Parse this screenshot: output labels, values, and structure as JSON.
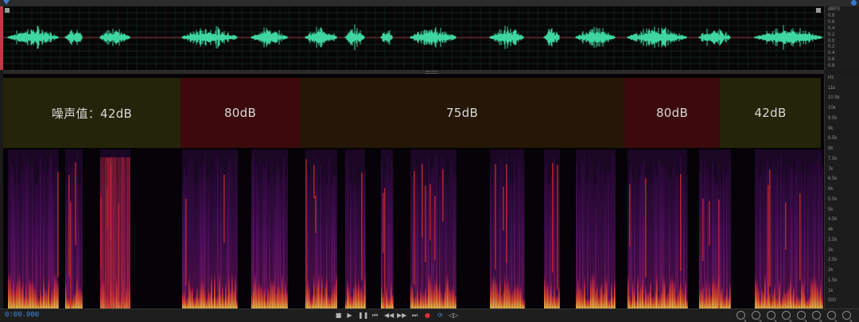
{
  "transport": {
    "time": "0:00.000"
  },
  "noise_bands": [
    {
      "label": "噪声值：42dB",
      "color": "#24240a"
    },
    {
      "label": "80dB",
      "color": "#3c0a0c"
    },
    {
      "label": "75dB",
      "color": "#251606"
    },
    {
      "label": "80dB",
      "color": "#3c0a0c"
    },
    {
      "label": "42dB",
      "color": "#24240a"
    }
  ],
  "waveform_ruler": {
    "labels": [
      "dBFS",
      "0.8",
      "0.6",
      "0.4",
      "0.2",
      "0.0",
      "0.2",
      "0.4",
      "0.6",
      "0.8"
    ]
  },
  "spectrogram_ruler": {
    "labels": [
      "Hz",
      "11k",
      "10.5k",
      "10k",
      "9.5k",
      "9k",
      "8.5k",
      "8k",
      "7.5k",
      "7k",
      "6.5k",
      "6k",
      "5.5k",
      "5k",
      "4.5k",
      "4k",
      "3.5k",
      "3k",
      "2.5k",
      "2k",
      "1.5k",
      "1k",
      "500"
    ]
  },
  "colors": {
    "waveform": "#3fd6a0",
    "timecode": "#3c8ee6",
    "playhead": "#c0384a"
  },
  "icons": {
    "transport": [
      "stop-icon",
      "play-icon",
      "pause-icon",
      "skip-to-start-icon",
      "rewind-icon",
      "fast-forward-icon",
      "skip-to-end-icon",
      "record-icon",
      "loop-icon",
      "skip-selection-icon"
    ],
    "zoom": [
      "zoom-in-amplitude-icon",
      "zoom-out-amplitude-icon",
      "zoom-in-time-icon",
      "zoom-out-time-icon",
      "zoom-in-point-icon",
      "zoom-out-point-icon",
      "zoom-to-selection-icon",
      "zoom-out-full-icon"
    ]
  }
}
